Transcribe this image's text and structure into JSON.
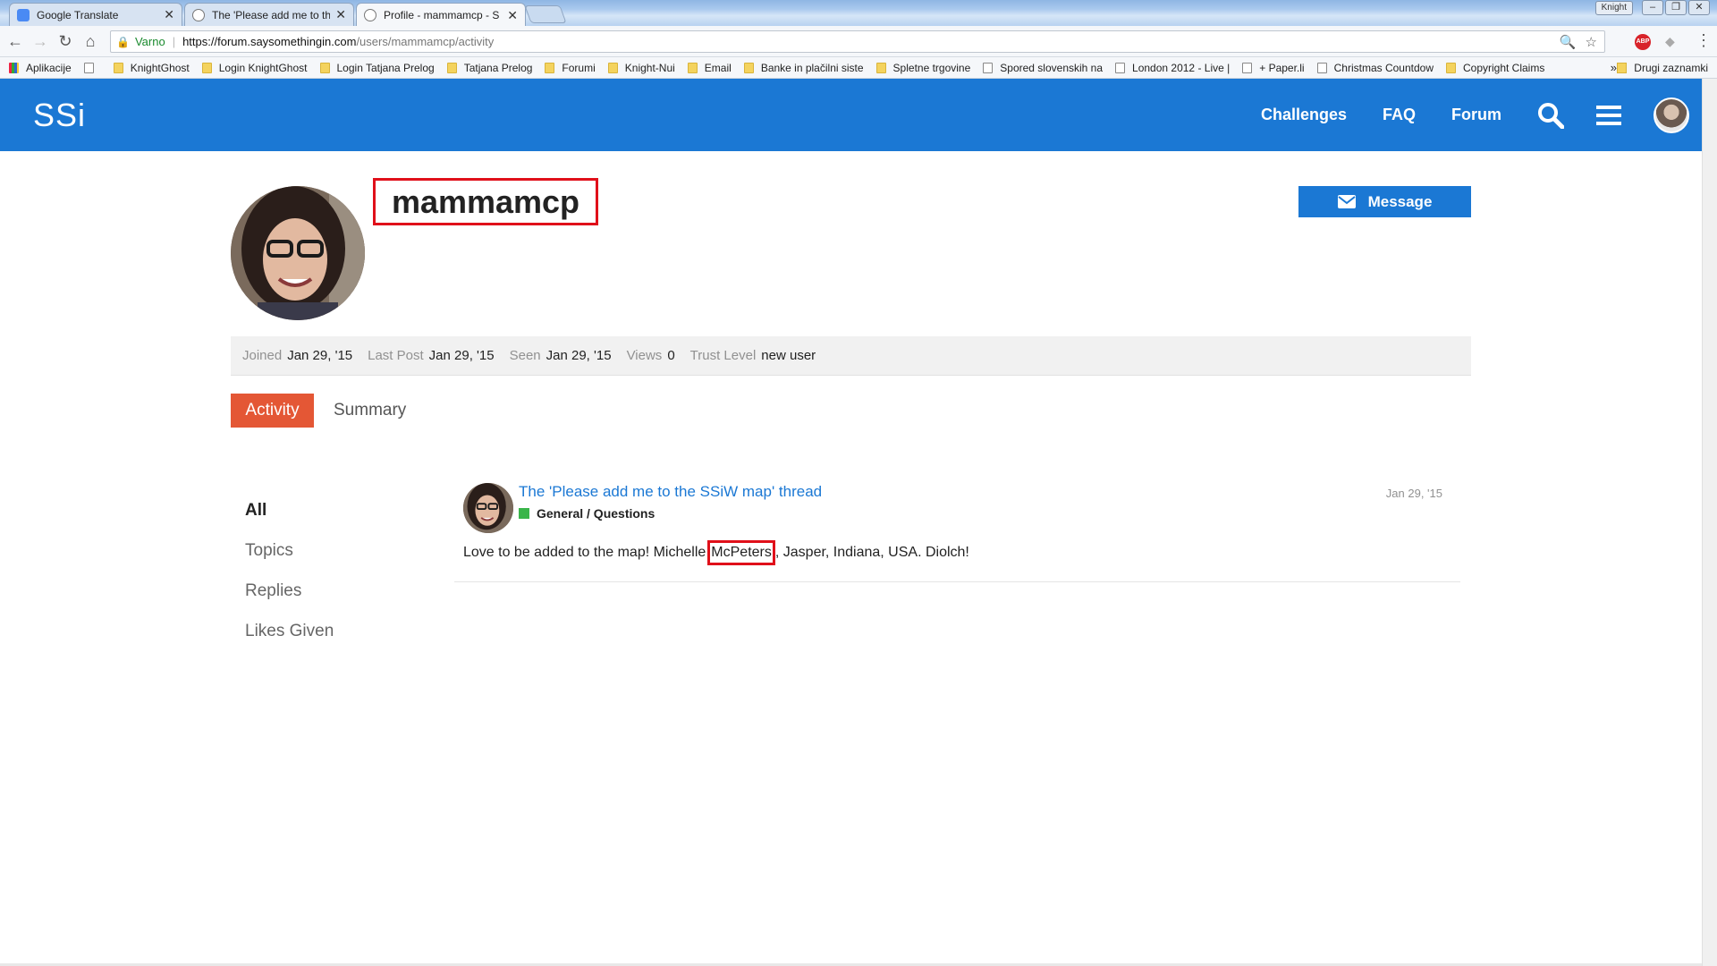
{
  "browser": {
    "tabs": [
      {
        "title": "Google Translate",
        "color": "#4a8af4"
      },
      {
        "title": "The 'Please add me to th",
        "color": "#a0a8b4"
      },
      {
        "title": "Profile - mammamcp - S",
        "color": "#a0a8b4"
      }
    ],
    "user_chip": "Knight",
    "secure_label": "Varno",
    "url_host": "https://forum.saysomethingin.com",
    "url_path": "/users/mammamcp/activity",
    "extension_label": "ABP",
    "bookmarks": [
      {
        "label": "Aplikacije",
        "icon": "grid"
      },
      {
        "label": "",
        "icon": "page"
      },
      {
        "label": "KnightGhost",
        "icon": "folder"
      },
      {
        "label": "Login KnightGhost",
        "icon": "folder"
      },
      {
        "label": "Login Tatjana Prelog",
        "icon": "folder"
      },
      {
        "label": "Tatjana Prelog",
        "icon": "folder"
      },
      {
        "label": "Forumi",
        "icon": "folder"
      },
      {
        "label": "Knight-Nui",
        "icon": "folder"
      },
      {
        "label": "Email",
        "icon": "folder"
      },
      {
        "label": "Banke in plačilni siste",
        "icon": "folder"
      },
      {
        "label": "Spletne trgovine",
        "icon": "folder"
      },
      {
        "label": "Spored slovenskih na",
        "icon": "page"
      },
      {
        "label": "London 2012 - Live |",
        "icon": "page"
      },
      {
        "label": "+ Paper.li",
        "icon": "page"
      },
      {
        "label": "Christmas Countdow",
        "icon": "page"
      },
      {
        "label": "Copyright Claims",
        "icon": "folder"
      }
    ],
    "bookmarks_more": "»",
    "bookmarks_other": "Drugi zaznamki"
  },
  "site": {
    "logo": "SSi",
    "nav": [
      "Challenges",
      "FAQ",
      "Forum"
    ],
    "brand_color": "#1b78d4"
  },
  "profile": {
    "username": "mammamcp",
    "message_button": "Message",
    "stats": [
      {
        "label": "Joined",
        "value": "Jan 29, '15"
      },
      {
        "label": "Last Post",
        "value": "Jan 29, '15"
      },
      {
        "label": "Seen",
        "value": "Jan 29, '15"
      },
      {
        "label": "Views",
        "value": "0"
      },
      {
        "label": "Trust Level",
        "value": "new user"
      }
    ],
    "tabs": [
      "Activity",
      "Summary"
    ],
    "filters": [
      "All",
      "Topics",
      "Replies",
      "Likes Given"
    ]
  },
  "post": {
    "title": "The 'Please add me to the SSiW map' thread",
    "category": "General / Questions",
    "date": "Jan 29, '15",
    "body_before": "Love to be added to the map! Michelle",
    "body_highlight": "McPeters",
    "body_after": ", Jasper, Indiana, USA. Diolch!"
  }
}
